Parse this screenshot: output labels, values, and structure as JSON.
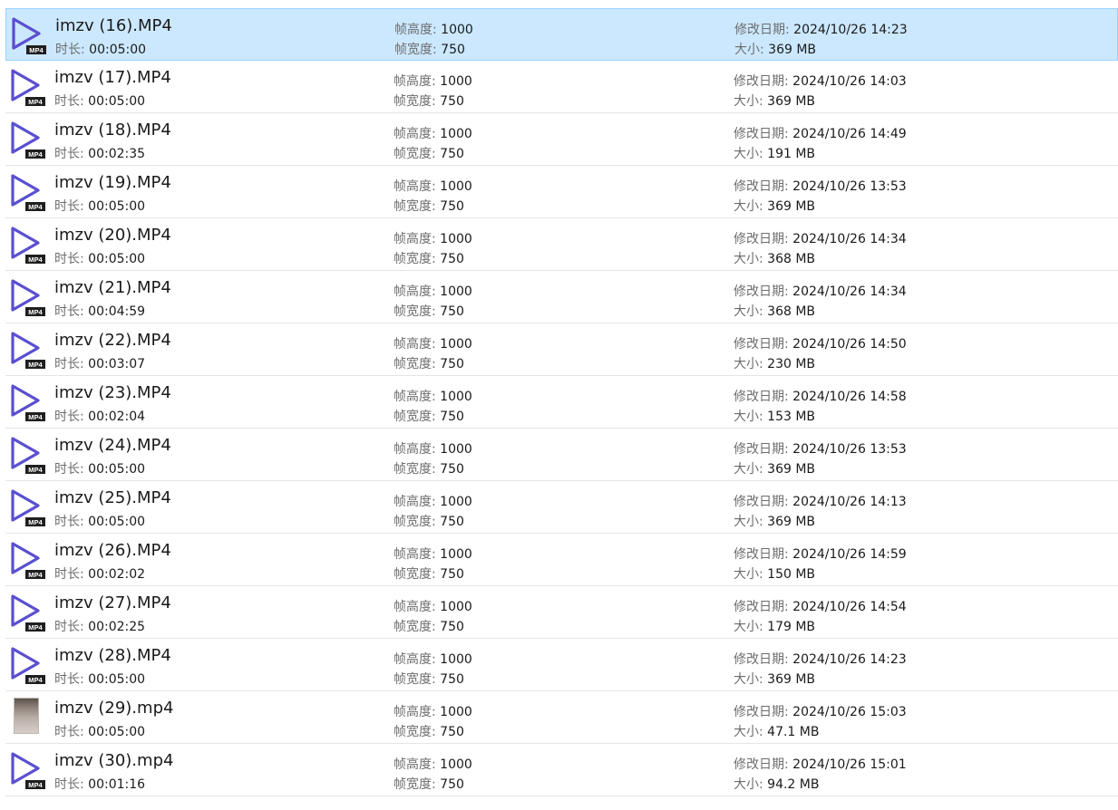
{
  "labels": {
    "duration": "时长:",
    "frame_height": "帧高度:",
    "frame_width": "帧宽度:",
    "modified": "修改日期:",
    "size": "大小:"
  },
  "badge": "MP4",
  "colors": {
    "icon_stroke": "#5a4fcf",
    "selected_bg": "#cce8ff",
    "selected_border": "#99d1ff"
  },
  "files": [
    {
      "name": "imzv (16).MP4",
      "duration": "00:05:00",
      "frame_height": "1000",
      "frame_width": "750",
      "modified": "2024/10/26 14:23",
      "size": "369 MB",
      "icon": "video-play-icon",
      "selected": true
    },
    {
      "name": "imzv (17).MP4",
      "duration": "00:05:00",
      "frame_height": "1000",
      "frame_width": "750",
      "modified": "2024/10/26 14:03",
      "size": "369 MB",
      "icon": "video-play-icon",
      "selected": false
    },
    {
      "name": "imzv (18).MP4",
      "duration": "00:02:35",
      "frame_height": "1000",
      "frame_width": "750",
      "modified": "2024/10/26 14:49",
      "size": "191 MB",
      "icon": "video-play-icon",
      "selected": false
    },
    {
      "name": "imzv (19).MP4",
      "duration": "00:05:00",
      "frame_height": "1000",
      "frame_width": "750",
      "modified": "2024/10/26 13:53",
      "size": "369 MB",
      "icon": "video-play-icon",
      "selected": false
    },
    {
      "name": "imzv (20).MP4",
      "duration": "00:05:00",
      "frame_height": "1000",
      "frame_width": "750",
      "modified": "2024/10/26 14:34",
      "size": "368 MB",
      "icon": "video-play-icon",
      "selected": false
    },
    {
      "name": "imzv (21).MP4",
      "duration": "00:04:59",
      "frame_height": "1000",
      "frame_width": "750",
      "modified": "2024/10/26 14:34",
      "size": "368 MB",
      "icon": "video-play-icon",
      "selected": false
    },
    {
      "name": "imzv (22).MP4",
      "duration": "00:03:07",
      "frame_height": "1000",
      "frame_width": "750",
      "modified": "2024/10/26 14:50",
      "size": "230 MB",
      "icon": "video-play-icon",
      "selected": false
    },
    {
      "name": "imzv (23).MP4",
      "duration": "00:02:04",
      "frame_height": "1000",
      "frame_width": "750",
      "modified": "2024/10/26 14:58",
      "size": "153 MB",
      "icon": "video-play-icon",
      "selected": false
    },
    {
      "name": "imzv (24).MP4",
      "duration": "00:05:00",
      "frame_height": "1000",
      "frame_width": "750",
      "modified": "2024/10/26 13:53",
      "size": "369 MB",
      "icon": "video-play-icon",
      "selected": false
    },
    {
      "name": "imzv (25).MP4",
      "duration": "00:05:00",
      "frame_height": "1000",
      "frame_width": "750",
      "modified": "2024/10/26 14:13",
      "size": "369 MB",
      "icon": "video-play-icon",
      "selected": false
    },
    {
      "name": "imzv (26).MP4",
      "duration": "00:02:02",
      "frame_height": "1000",
      "frame_width": "750",
      "modified": "2024/10/26 14:59",
      "size": "150 MB",
      "icon": "video-play-icon",
      "selected": false
    },
    {
      "name": "imzv (27).MP4",
      "duration": "00:02:25",
      "frame_height": "1000",
      "frame_width": "750",
      "modified": "2024/10/26 14:54",
      "size": "179 MB",
      "icon": "video-play-icon",
      "selected": false
    },
    {
      "name": "imzv (28).MP4",
      "duration": "00:05:00",
      "frame_height": "1000",
      "frame_width": "750",
      "modified": "2024/10/26 14:23",
      "size": "369 MB",
      "icon": "video-play-icon",
      "selected": false
    },
    {
      "name": "imzv (29).mp4",
      "duration": "00:05:00",
      "frame_height": "1000",
      "frame_width": "750",
      "modified": "2024/10/26 15:03",
      "size": "47.1 MB",
      "icon": "video-thumbnail",
      "selected": false
    },
    {
      "name": "imzv (30).mp4",
      "duration": "00:01:16",
      "frame_height": "1000",
      "frame_width": "750",
      "modified": "2024/10/26 15:01",
      "size": "94.2 MB",
      "icon": "video-play-icon",
      "selected": false
    }
  ]
}
